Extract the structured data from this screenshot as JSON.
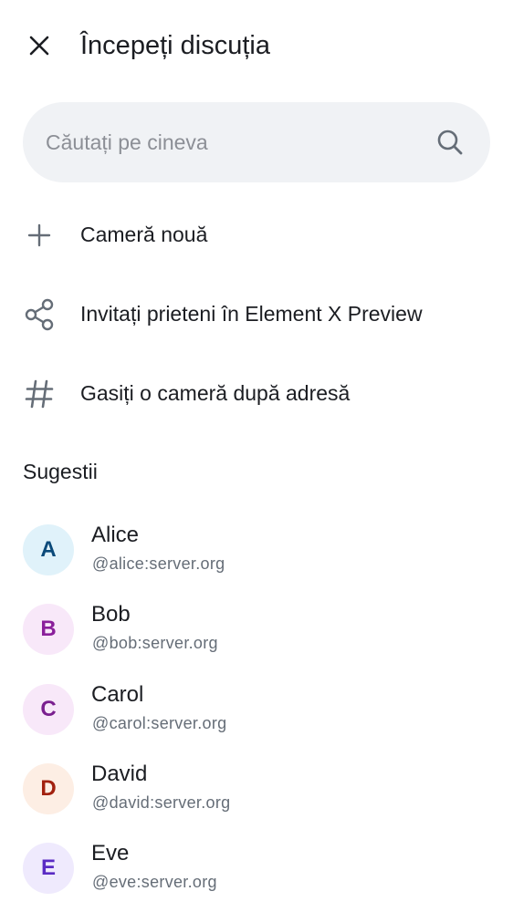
{
  "header": {
    "title": "Începeți discuția",
    "close_icon": "close-icon"
  },
  "search": {
    "placeholder": "Căutați pe cineva",
    "value": "",
    "icon": "search-icon"
  },
  "actions": [
    {
      "label": "Cameră nouă",
      "icon": "plus-icon"
    },
    {
      "label": "Invitați prieteni în Element X Preview",
      "icon": "share-icon"
    },
    {
      "label": "Gasiți o cameră după adresă",
      "icon": "hash-icon"
    }
  ],
  "suggestions": {
    "title": "Sugestii",
    "users": [
      {
        "initial": "A",
        "name": "Alice",
        "id": "@alice:server.org",
        "avatar_bg": "#e0f2fa",
        "avatar_fg": "#0b4a7a"
      },
      {
        "initial": "B",
        "name": "Bob",
        "id": "@bob:server.org",
        "avatar_bg": "#f8e8f9",
        "avatar_fg": "#8a1f9b"
      },
      {
        "initial": "C",
        "name": "Carol",
        "id": "@carol:server.org",
        "avatar_bg": "#f8e8f9",
        "avatar_fg": "#7a1f8f"
      },
      {
        "initial": "D",
        "name": "David",
        "id": "@david:server.org",
        "avatar_bg": "#fdeee4",
        "avatar_fg": "#a2210f"
      },
      {
        "initial": "E",
        "name": "Eve",
        "id": "@eve:server.org",
        "avatar_bg": "#efeafd",
        "avatar_fg": "#5a2bc4"
      }
    ]
  },
  "colors": {
    "text_primary": "#1b1d22",
    "text_secondary": "#656d77",
    "search_bg": "#f0f2f5",
    "icon_color": "#656d77"
  }
}
